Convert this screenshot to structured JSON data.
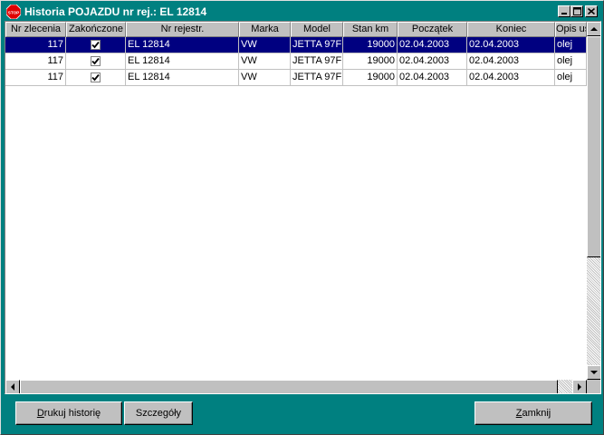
{
  "window": {
    "title": "Historia POJAZDU nr rej.: EL 12814",
    "icon": "stop-sign-icon",
    "icon_text": "STOP",
    "controls": [
      "minimize",
      "maximize",
      "close"
    ]
  },
  "grid": {
    "columns": [
      {
        "key": "nr",
        "label": "Nr zlecenia"
      },
      {
        "key": "done",
        "label": "Zakończone"
      },
      {
        "key": "reg",
        "label": "Nr rejestr."
      },
      {
        "key": "make",
        "label": "Marka"
      },
      {
        "key": "model",
        "label": "Model"
      },
      {
        "key": "km",
        "label": "Stan km"
      },
      {
        "key": "start",
        "label": "Początek"
      },
      {
        "key": "end",
        "label": "Koniec"
      },
      {
        "key": "desc",
        "label": "Opis us"
      }
    ],
    "rows": [
      {
        "nr": "117",
        "done": true,
        "reg": "EL 12814",
        "make": "VW",
        "model": "JETTA 97F",
        "km": "19000",
        "start": "02.04.2003",
        "end": "02.04.2003",
        "desc": "olej",
        "selected": true
      },
      {
        "nr": "117",
        "done": true,
        "reg": "EL 12814",
        "make": "VW",
        "model": "JETTA 97F",
        "km": "19000",
        "start": "02.04.2003",
        "end": "02.04.2003",
        "desc": "olej",
        "selected": false
      },
      {
        "nr": "117",
        "done": true,
        "reg": "EL 12814",
        "make": "VW",
        "model": "JETTA 97F",
        "km": "19000",
        "start": "02.04.2003",
        "end": "02.04.2003",
        "desc": "olej",
        "selected": false
      }
    ]
  },
  "buttons": {
    "print_history": {
      "first": "D",
      "rest": "rukuj historię"
    },
    "details": {
      "label": "Szczegóły"
    },
    "close": {
      "first": "Z",
      "rest": "amknij"
    }
  },
  "colors": {
    "window_bg": "#008080",
    "title_bg": "#008080",
    "selection": "#000080",
    "face": "#c0c0c0"
  }
}
